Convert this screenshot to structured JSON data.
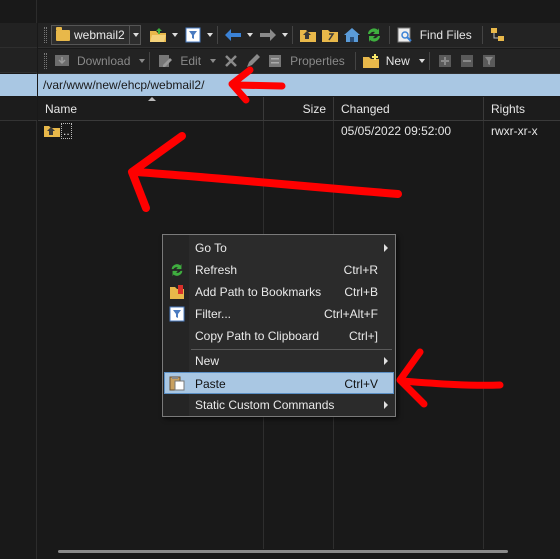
{
  "toolbar1": {
    "location": "webmail2",
    "find_files": "Find Files"
  },
  "toolbar2": {
    "download": "Download",
    "edit": "Edit",
    "properties": "Properties",
    "new": "New"
  },
  "path": "/var/www/new/ehcp/webmail2/",
  "columns": {
    "name": "Name",
    "size": "Size",
    "changed": "Changed",
    "rights": "Rights"
  },
  "rows": [
    {
      "name": "..",
      "size": "",
      "changed": "05/05/2022 09:52:00",
      "rights": "rwxr-xr-x"
    }
  ],
  "context_menu": {
    "items": [
      {
        "label": "Go To",
        "shortcut": "",
        "submenu": true
      },
      {
        "label": "Refresh",
        "shortcut": "Ctrl+R",
        "icon": "refresh-icon"
      },
      {
        "label": "Add Path to Bookmarks",
        "shortcut": "Ctrl+B",
        "icon": "bookmark-icon"
      },
      {
        "label": "Filter...",
        "shortcut": "Ctrl+Alt+F",
        "icon": "filter-icon"
      },
      {
        "label": "Copy Path to Clipboard",
        "shortcut": "Ctrl+]"
      },
      {
        "label": "New",
        "shortcut": "",
        "submenu": true
      },
      {
        "label": "Paste",
        "shortcut": "Ctrl+V",
        "icon": "paste-icon",
        "highlighted": true
      },
      {
        "label": "Static Custom Commands",
        "shortcut": "",
        "submenu": true
      }
    ]
  },
  "colors": {
    "path_bar": "#a9c7e3",
    "highlight": "#a9c7e3",
    "annotation": "#ff0000",
    "background": "#191919"
  }
}
